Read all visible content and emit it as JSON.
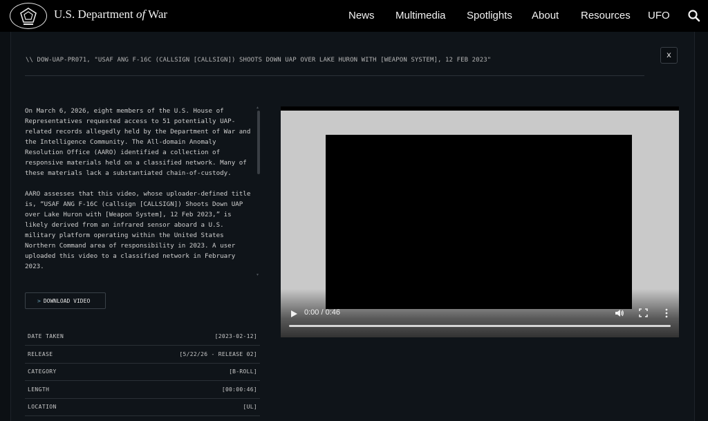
{
  "header": {
    "brand_prefix": "U.S. Department ",
    "brand_of": "of",
    "brand_suffix": " War",
    "nav": [
      "News",
      "Multimedia",
      "Spotlights",
      "About",
      "Resources",
      "UFO"
    ]
  },
  "modal": {
    "close_label": "x",
    "title": "\\\\  DOW-UAP-PR071, \"USAF ANG F-16C (CALLSIGN [CALLSIGN]) SHOOTS DOWN UAP OVER LAKE HURON WITH [WEAPON SYSTEM], 12 FEB 2023\"",
    "paragraphs": [
      "On March 6, 2026, eight members of the U.S. House of Representatives requested access to 51 potentially UAP-related records allegedly held by the Department of War and the Intelligence Community. The All-domain Anomaly Resolution Office (AARO) identified a collection of responsive materials held on a classified network. Many of these materials lack a substantiated chain-of-custody.",
      "AARO assesses that this video, whose uploader-defined title is, “USAF ANG F-16C (callsign [CALLSIGN]) Shoots Down UAP over Lake Huron with [Weapon System], 12 Feb 2023,” is likely derived from an infrared sensor aboard a U.S. military platform operating within the United States Northern Command area of responsibility in 2023. A user uploaded this video to a classified network in February 2023."
    ],
    "download_label": "DOWNLOAD VIDEO",
    "download_chevron": ">",
    "meta": [
      {
        "key": "DATE TAKEN",
        "value": "[2023-02-12]"
      },
      {
        "key": "RELEASE",
        "value": "[5/22/26 - RELEASE 02]"
      },
      {
        "key": "CATEGORY",
        "value": "[B-ROLL]"
      },
      {
        "key": "LENGTH",
        "value": "[00:00:46]"
      },
      {
        "key": "LOCATION",
        "value": "[UL]"
      }
    ]
  },
  "video": {
    "time": "0:00 / 0:46",
    "progress": 0
  },
  "icons": {
    "logo": "pentagon-seal-icon",
    "search": "search-icon",
    "play": "play-icon",
    "volume": "volume-icon",
    "fullscreen": "fullscreen-icon",
    "more": "more-vertical-icon"
  }
}
